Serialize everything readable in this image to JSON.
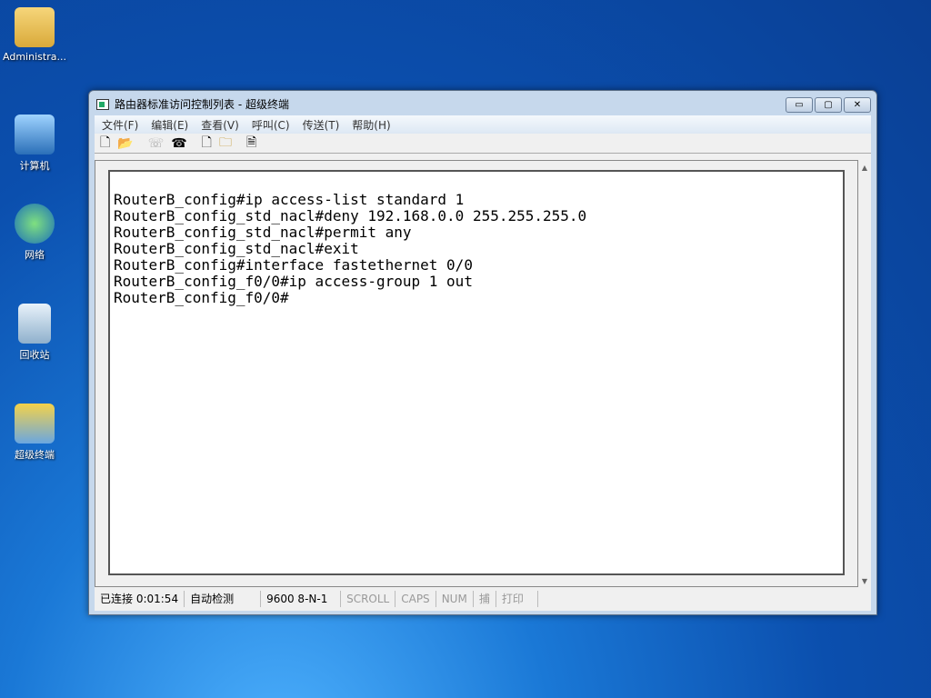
{
  "desktop": {
    "icons": [
      "Administra...",
      "计算机",
      "网络",
      "回收站",
      "超级终端"
    ]
  },
  "window": {
    "title": "路由器标准访问控制列表 - 超级终端",
    "controls": [
      "▭",
      "▢",
      "✕"
    ]
  },
  "menu": [
    "文件(F)",
    "编辑(E)",
    "查看(V)",
    "呼叫(C)",
    "传送(T)",
    "帮助(H)"
  ],
  "toolbar": [
    "new-icon",
    "open-icon",
    "disconnect-icon",
    "dial-icon",
    "send-icon",
    "receive-icon",
    "properties-icon"
  ],
  "terminal": {
    "lines": [
      "RouterB_config#ip access-list standard 1",
      "RouterB_config_std_nacl#deny 192.168.0.0 255.255.255.0",
      "RouterB_config_std_nacl#permit any",
      "RouterB_config_std_nacl#exit",
      "RouterB_config#interface fastethernet 0/0",
      "RouterB_config_f0/0#ip access-group 1 out",
      "RouterB_config_f0/0#"
    ]
  },
  "status": {
    "connected": "已连接 0:01:54",
    "detect": "自动检测",
    "settings": "9600 8-N-1",
    "scroll": "SCROLL",
    "caps": "CAPS",
    "num": "NUM",
    "capture": "捕",
    "print": "打印"
  }
}
